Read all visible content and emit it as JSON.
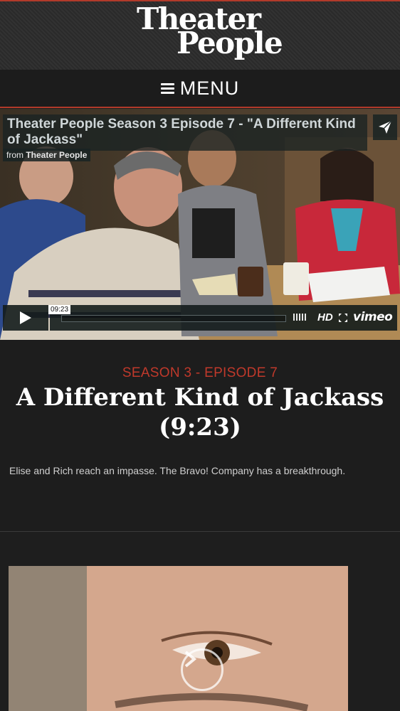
{
  "header": {
    "logo_line1": "Theater",
    "logo_line2": "People"
  },
  "nav": {
    "menu_label": "MENU"
  },
  "video": {
    "title": "Theater People Season 3 Episode 7 - \"A Different Kind of Jackass\"",
    "from_prefix": "from",
    "from_channel": "Theater People",
    "time_tooltip": "09:23",
    "hd_label": "HD",
    "brand": "vimeo"
  },
  "episode": {
    "label": "SEASON 3 - EPISODE 7",
    "title": "A Different Kind of Jackass (9:23)",
    "description": "Elise and Rich reach an impasse. The Bravo! Company has a breakthrough."
  },
  "colors": {
    "accent": "#c0392b",
    "background": "#1e1e1e"
  }
}
